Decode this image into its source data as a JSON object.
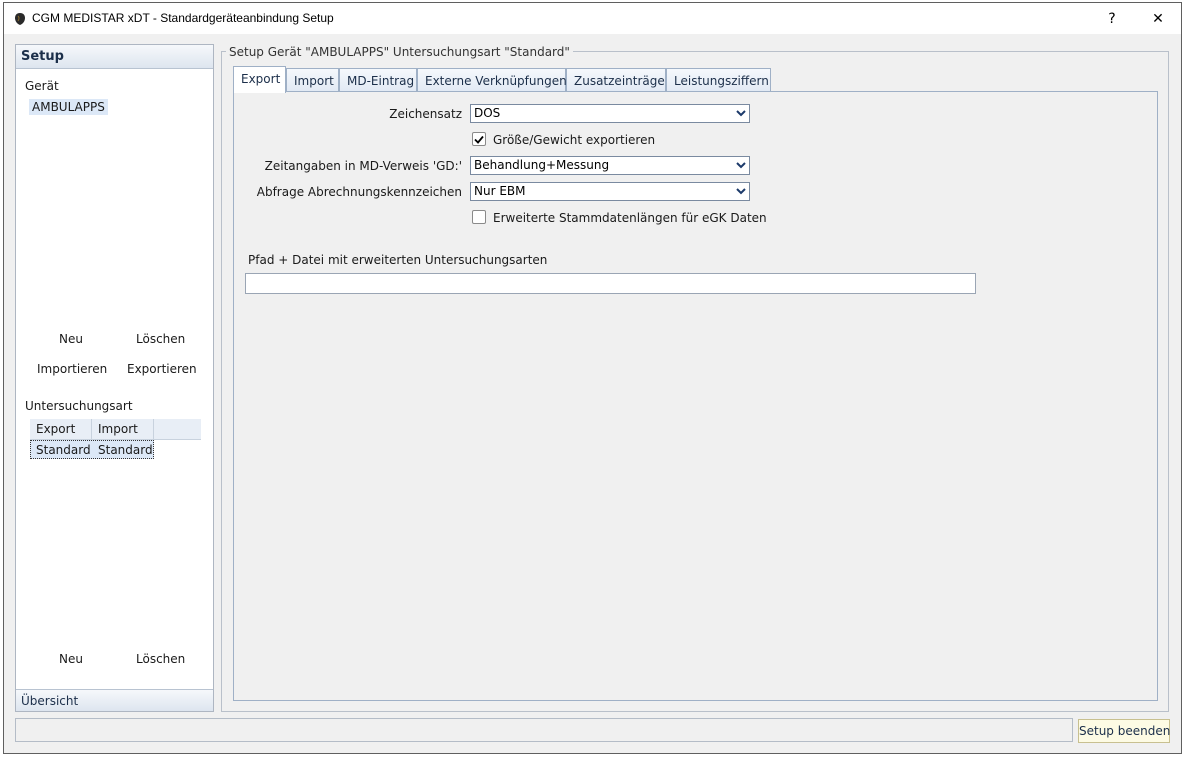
{
  "window": {
    "title": "CGM MEDISTAR xDT - Standardgeräteanbindung  Setup",
    "help_label": "?",
    "close_label": "✕"
  },
  "left": {
    "header": "Setup",
    "geraet_label": "Gerät",
    "geraet_selected": "AMBULAPPS",
    "btn_neu": "Neu",
    "btn_loeschen": "Löschen",
    "btn_importieren": "Importieren",
    "btn_exportieren": "Exportieren",
    "untersuchungsart_label": "Untersuchungsart",
    "table_headers": [
      "Export",
      "Import"
    ],
    "table_row": [
      "Standard",
      "Standard"
    ],
    "btn_neu2": "Neu",
    "btn_loeschen2": "Löschen",
    "footer": "Übersicht"
  },
  "group_title": "Setup Gerät \"AMBULAPPS\" Untersuchungsart \"Standard\"",
  "tabs": [
    "Export",
    "Import",
    "MD-Eintrag",
    "Externe Verknüpfungen",
    "Zusatzeinträge",
    "Leistungsziffern"
  ],
  "form": {
    "zeichensatz_label": "Zeichensatz",
    "zeichensatz_value": "DOS",
    "groesse_label": "Größe/Gewicht exportieren",
    "groesse_checked": true,
    "zeitangaben_label": "Zeitangaben in MD-Verweis 'GD:'",
    "zeitangaben_value": "Behandlung+Messung",
    "abfrage_label": "Abfrage Abrechnungskennzeichen",
    "abfrage_value": "Nur EBM",
    "erweitert_label": "Erweiterte Stammdatenlängen für eGK Daten",
    "erweitert_checked": false,
    "pfad_label": "Pfad + Datei mit erweiterten Untersuchungsarten",
    "pfad_value": ""
  },
  "footer_button": "Setup beenden"
}
